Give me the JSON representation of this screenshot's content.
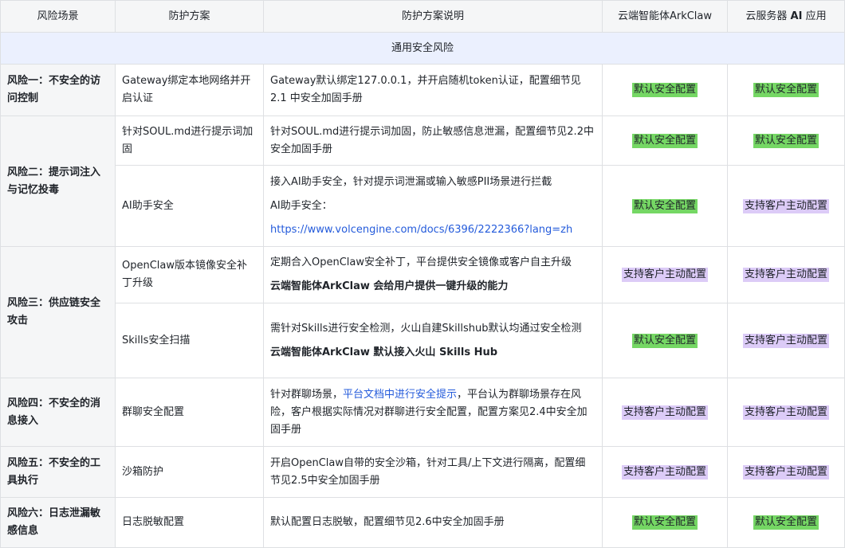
{
  "headers": {
    "risk": "风险场景",
    "plan": "防护方案",
    "desc": "防护方案说明",
    "arkclaw": "云端智能体ArkClaw",
    "ecs_a": "云服务器 ",
    "ecs_b": "AI",
    "ecs_c": " 应用"
  },
  "section": "通用安全风险",
  "badges": {
    "default": "默认安全配置",
    "customer": "支持客户主动配置"
  },
  "rows": {
    "r1": {
      "risk": "风险一：不安全的访问控制",
      "plan": "Gateway绑定本地网络并开启认证",
      "desc": "Gateway默认绑定127.0.0.1，并开启随机token认证，配置细节见2.1 中安全加固手册"
    },
    "r2": {
      "risk": "风险二：提示词注入与记忆投毒",
      "a": {
        "plan": "针对SOUL.md进行提示词加固",
        "desc": "针对SOUL.md进行提示词加固，防止敏感信息泄漏，配置细节见2.2中安全加固手册"
      },
      "b": {
        "plan": "AI助手安全",
        "desc1": "接入AI助手安全，针对提示词泄漏或输入敏感PII场景进行拦截",
        "desc2": "AI助手安全：",
        "link": "https://www.volcengine.com/docs/6396/2222366?lang=zh"
      }
    },
    "r3": {
      "risk": "风险三：供应链安全攻击",
      "a": {
        "plan": "OpenClaw版本镜像安全补丁升级",
        "desc1": "定期合入OpenClaw安全补丁，平台提供安全镜像或客户自主升级",
        "desc2": "云端智能体ArkClaw 会给用户提供一键升级的能力"
      },
      "b": {
        "plan": "Skills安全扫描",
        "desc1": "需针对Skills进行安全检测，火山自建Skillshub默认均通过安全检测",
        "desc2": "云端智能体ArkClaw 默认接入火山 Skills Hub"
      }
    },
    "r4": {
      "risk": "风险四：不安全的消息接入",
      "plan": "群聊安全配置",
      "desc_pre": "针对群聊场景，",
      "desc_hl": "平台文档中进行安全提示",
      "desc_post": "，平台认为群聊场景存在风险，客户根据实际情况对群聊进行安全配置，配置方案见2.4中安全加固手册"
    },
    "r5": {
      "risk": "风险五：不安全的工具执行",
      "plan": "沙箱防护",
      "desc": "开启OpenClaw自带的安全沙箱，针对工具/上下文进行隔离，配置细节见2.5中安全加固手册"
    },
    "r6": {
      "risk": "风险六：日志泄漏敏感信息",
      "plan": "日志脱敏配置",
      "desc": "默认配置日志脱敏，配置细节见2.6中安全加固手册"
    }
  },
  "colors": {
    "header_bg": "#f5f6f7",
    "section_bg": "#ebf0fe",
    "border": "#dee0e3",
    "badge_default": "#75d764",
    "badge_customer": "#dccbf7",
    "link": "#245bdb"
  }
}
